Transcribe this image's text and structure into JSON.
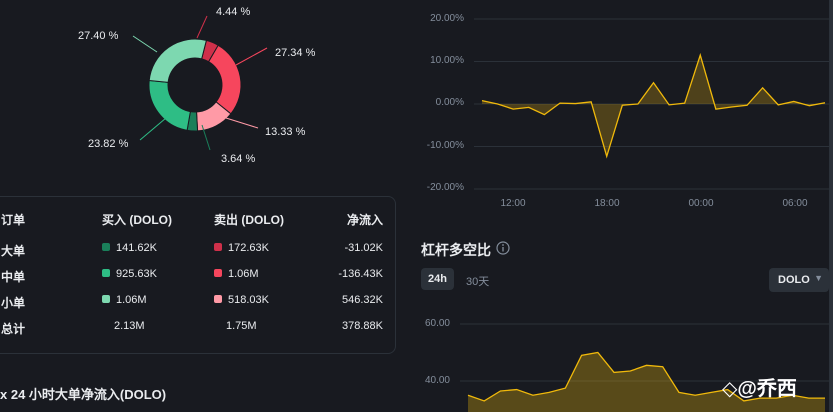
{
  "donut": {
    "labels": [
      {
        "text": "4.44 %"
      },
      {
        "text": "27.34 %"
      },
      {
        "text": "13.33 %"
      },
      {
        "text": "3.64 %"
      },
      {
        "text": "23.82 %"
      },
      {
        "text": "27.40 %"
      }
    ],
    "slices": [
      {
        "value": 4.44,
        "color": "#cf304a"
      },
      {
        "value": 27.34,
        "color": "#f6465d"
      },
      {
        "value": 13.33,
        "color": "#ff9aa6"
      },
      {
        "value": 3.64,
        "color": "#1a7f5a"
      },
      {
        "value": 23.82,
        "color": "#2ebd85"
      },
      {
        "value": 27.4,
        "color": "#7dd8b0"
      }
    ]
  },
  "orders_table": {
    "headers": {
      "order": "订单",
      "buy": "买入 (DOLO)",
      "sell": "卖出 (DOLO)",
      "net": "净流入"
    },
    "rows": [
      {
        "name": "大单",
        "buy": "141.62K",
        "sell": "172.63K",
        "net": "-31.02K",
        "buy_color": "#1a7f5a",
        "sell_color": "#cf304a"
      },
      {
        "name": "中单",
        "buy": "925.63K",
        "sell": "1.06M",
        "net": "-136.43K",
        "buy_color": "#2ebd85",
        "sell_color": "#f6465d"
      },
      {
        "name": "小单",
        "buy": "1.06M",
        "sell": "518.03K",
        "net": "546.32K",
        "buy_color": "#7dd8b0",
        "sell_color": "#ff9aa6"
      },
      {
        "name": "总计",
        "buy": "2.13M",
        "sell": "1.75M",
        "net": "378.88K"
      }
    ]
  },
  "bottom_left_title": "x 24 小时大单净流入(DOLO)",
  "chart_data": [
    {
      "type": "line",
      "yticks": [
        "20.00%",
        "10.00%",
        "0.00%",
        "-10.00%",
        "-20.00%"
      ],
      "ylim": [
        -20,
        20
      ],
      "xticks": [
        "12:00",
        "18:00",
        "00:00",
        "06:00"
      ],
      "values": [
        0.8,
        0.0,
        -1.2,
        -0.8,
        -2.5,
        0.2,
        0.1,
        0.5,
        -12.3,
        -0.3,
        0.0,
        5.0,
        -0.2,
        0.2,
        11.5,
        -1.2,
        -0.7,
        -0.3,
        3.8,
        -0.2,
        0.6,
        -0.4,
        0.3
      ],
      "color": "#f0b90b"
    },
    {
      "type": "area",
      "yticks": [
        "60.00",
        "40.00"
      ],
      "ylim": [
        30,
        70
      ],
      "values": [
        35,
        33,
        36.5,
        37,
        35,
        36,
        37.5,
        49,
        50,
        43,
        43.5,
        45.5,
        45,
        36,
        35,
        36,
        37,
        33,
        34,
        34,
        35,
        34,
        34
      ],
      "color": "#f0b90b"
    }
  ],
  "leverage": {
    "title": "杠杆多空比",
    "info_icon": "info-icon",
    "tabs": [
      "24h",
      "30天"
    ],
    "dropdown_value": "DOLO"
  },
  "watermark": "◇@乔西"
}
